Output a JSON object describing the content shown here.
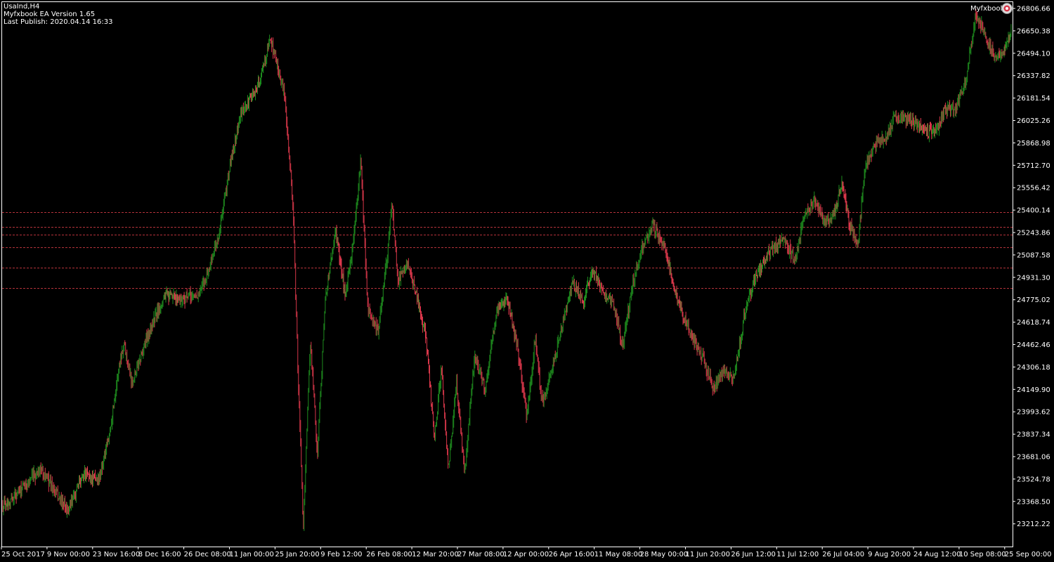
{
  "header": {
    "symbol_tf": "UsaInd,H4",
    "ea_version": "Myfxbook EA Version 1.65",
    "last_publish": "Last Publish: 2020.04.14 16:33"
  },
  "brand": {
    "label": "Myfxbook",
    "icon": "myfxbook-logo-icon"
  },
  "colors": {
    "background": "#000000",
    "frame": "#ffffff",
    "bull": "#1e8c1e",
    "bear": "#d8374a",
    "level_line": "#b4323a",
    "text": "#ffffff"
  },
  "chart_data": {
    "type": "candlestick",
    "symbol": "UsaInd",
    "timeframe": "H4",
    "grid": false,
    "y_ticks": [
      "26806.66",
      "26650.38",
      "26494.10",
      "26337.82",
      "26181.54",
      "26025.26",
      "25868.98",
      "25712.70",
      "25556.42",
      "25400.14",
      "25243.86",
      "25087.58",
      "24931.30",
      "24775.02",
      "24618.74",
      "24462.46",
      "24306.18",
      "24149.90",
      "23993.62",
      "23837.34",
      "23681.06",
      "23524.78",
      "23368.50",
      "23212.22"
    ],
    "x_ticks": [
      "25 Oct 2017",
      "9 Nov 00:00",
      "23 Nov 16:00",
      "8 Dec 16:00",
      "26 Dec 08:00",
      "11 Jan 00:00",
      "25 Jan 20:00",
      "9 Feb 12:00",
      "26 Feb 08:00",
      "12 Mar 20:00",
      "27 Mar 08:00",
      "12 Apr 00:00",
      "26 Apr 16:00",
      "11 May 08:00",
      "28 May 00:00",
      "11 Jun 20:00",
      "26 Jun 12:00",
      "11 Jul 12:00",
      "26 Jul 04:00",
      "9 Aug 20:00",
      "24 Aug 12:00",
      "10 Sep 08:00",
      "25 Sep 00:00"
    ],
    "ylim": [
      23140,
      26820
    ],
    "horizontal_levels": [
      25385,
      25285,
      25230,
      25140,
      24997,
      24858
    ],
    "price_path": [
      {
        "x": 0.0,
        "y": 23340
      },
      {
        "x": 0.02,
        "y": 23460
      },
      {
        "x": 0.038,
        "y": 23600
      },
      {
        "x": 0.055,
        "y": 23400
      },
      {
        "x": 0.065,
        "y": 23300
      },
      {
        "x": 0.08,
        "y": 23570
      },
      {
        "x": 0.095,
        "y": 23510
      },
      {
        "x": 0.105,
        "y": 23800
      },
      {
        "x": 0.115,
        "y": 24300
      },
      {
        "x": 0.12,
        "y": 24480
      },
      {
        "x": 0.128,
        "y": 24200
      },
      {
        "x": 0.145,
        "y": 24550
      },
      {
        "x": 0.16,
        "y": 24800
      },
      {
        "x": 0.175,
        "y": 24780
      },
      {
        "x": 0.195,
        "y": 24810
      },
      {
        "x": 0.205,
        "y": 25000
      },
      {
        "x": 0.215,
        "y": 25250
      },
      {
        "x": 0.225,
        "y": 25700
      },
      {
        "x": 0.235,
        "y": 26050
      },
      {
        "x": 0.245,
        "y": 26170
      },
      {
        "x": 0.255,
        "y": 26300
      },
      {
        "x": 0.265,
        "y": 26600
      },
      {
        "x": 0.272,
        "y": 26420
      },
      {
        "x": 0.28,
        "y": 26170
      },
      {
        "x": 0.288,
        "y": 25400
      },
      {
        "x": 0.293,
        "y": 24200
      },
      {
        "x": 0.298,
        "y": 23200
      },
      {
        "x": 0.305,
        "y": 24500
      },
      {
        "x": 0.312,
        "y": 23700
      },
      {
        "x": 0.32,
        "y": 24800
      },
      {
        "x": 0.33,
        "y": 25250
      },
      {
        "x": 0.34,
        "y": 24800
      },
      {
        "x": 0.348,
        "y": 25200
      },
      {
        "x": 0.355,
        "y": 25750
      },
      {
        "x": 0.362,
        "y": 24700
      },
      {
        "x": 0.372,
        "y": 24550
      },
      {
        "x": 0.38,
        "y": 25000
      },
      {
        "x": 0.386,
        "y": 25450
      },
      {
        "x": 0.392,
        "y": 24900
      },
      {
        "x": 0.4,
        "y": 25050
      },
      {
        "x": 0.41,
        "y": 24800
      },
      {
        "x": 0.42,
        "y": 24500
      },
      {
        "x": 0.428,
        "y": 23800
      },
      {
        "x": 0.435,
        "y": 24300
      },
      {
        "x": 0.442,
        "y": 23600
      },
      {
        "x": 0.45,
        "y": 24200
      },
      {
        "x": 0.458,
        "y": 23550
      },
      {
        "x": 0.468,
        "y": 24400
      },
      {
        "x": 0.478,
        "y": 24150
      },
      {
        "x": 0.49,
        "y": 24700
      },
      {
        "x": 0.5,
        "y": 24800
      },
      {
        "x": 0.51,
        "y": 24450
      },
      {
        "x": 0.52,
        "y": 23950
      },
      {
        "x": 0.528,
        "y": 24500
      },
      {
        "x": 0.535,
        "y": 24050
      },
      {
        "x": 0.545,
        "y": 24300
      },
      {
        "x": 0.555,
        "y": 24600
      },
      {
        "x": 0.565,
        "y": 24900
      },
      {
        "x": 0.575,
        "y": 24750
      },
      {
        "x": 0.585,
        "y": 24980
      },
      {
        "x": 0.595,
        "y": 24820
      },
      {
        "x": 0.605,
        "y": 24750
      },
      {
        "x": 0.615,
        "y": 24450
      },
      {
        "x": 0.625,
        "y": 24900
      },
      {
        "x": 0.635,
        "y": 25150
      },
      {
        "x": 0.645,
        "y": 25300
      },
      {
        "x": 0.655,
        "y": 25150
      },
      {
        "x": 0.665,
        "y": 24900
      },
      {
        "x": 0.675,
        "y": 24650
      },
      {
        "x": 0.685,
        "y": 24500
      },
      {
        "x": 0.695,
        "y": 24350
      },
      {
        "x": 0.705,
        "y": 24150
      },
      {
        "x": 0.715,
        "y": 24300
      },
      {
        "x": 0.725,
        "y": 24200
      },
      {
        "x": 0.735,
        "y": 24650
      },
      {
        "x": 0.745,
        "y": 24900
      },
      {
        "x": 0.755,
        "y": 25050
      },
      {
        "x": 0.765,
        "y": 25150
      },
      {
        "x": 0.775,
        "y": 25200
      },
      {
        "x": 0.785,
        "y": 25050
      },
      {
        "x": 0.795,
        "y": 25350
      },
      {
        "x": 0.805,
        "y": 25480
      },
      {
        "x": 0.815,
        "y": 25300
      },
      {
        "x": 0.825,
        "y": 25380
      },
      {
        "x": 0.832,
        "y": 25600
      },
      {
        "x": 0.84,
        "y": 25300
      },
      {
        "x": 0.848,
        "y": 25150
      },
      {
        "x": 0.855,
        "y": 25700
      },
      {
        "x": 0.865,
        "y": 25850
      },
      {
        "x": 0.875,
        "y": 25900
      },
      {
        "x": 0.885,
        "y": 26050
      },
      {
        "x": 0.895,
        "y": 26050
      },
      {
        "x": 0.905,
        "y": 26000
      },
      {
        "x": 0.915,
        "y": 25950
      },
      {
        "x": 0.925,
        "y": 25950
      },
      {
        "x": 0.935,
        "y": 26100
      },
      {
        "x": 0.945,
        "y": 26100
      },
      {
        "x": 0.955,
        "y": 26300
      },
      {
        "x": 0.965,
        "y": 26780
      },
      {
        "x": 0.975,
        "y": 26600
      },
      {
        "x": 0.985,
        "y": 26450
      },
      {
        "x": 0.992,
        "y": 26500
      },
      {
        "x": 1.0,
        "y": 26650
      }
    ]
  }
}
